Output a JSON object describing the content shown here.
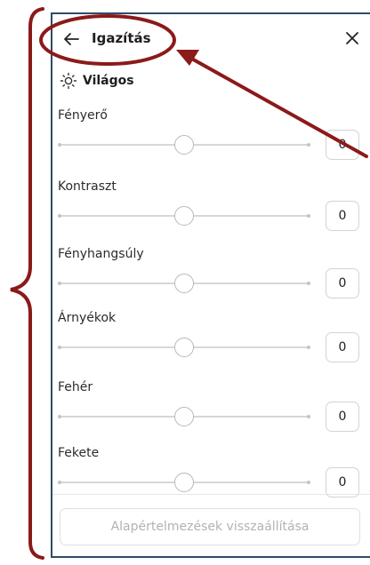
{
  "header": {
    "title": "Igazítás",
    "back_icon": "arrow-left-icon",
    "close_icon": "close-icon"
  },
  "section": {
    "title": "Világos",
    "icon": "sun-icon"
  },
  "sliders": [
    {
      "label": "Fényerő",
      "value": "0",
      "level": 0.5
    },
    {
      "label": "Kontraszt",
      "value": "0",
      "level": 0.5
    },
    {
      "label": "Fényhangsúly",
      "value": "0",
      "level": 0.5
    },
    {
      "label": "Árnyékok",
      "value": "0",
      "level": 0.5
    },
    {
      "label": "Fehér",
      "value": "0",
      "level": 0.5
    },
    {
      "label": "Fekete",
      "value": "0",
      "level": 0.5
    }
  ],
  "footer": {
    "reset_label": "Alapértelmezések visszaállítása"
  },
  "colors": {
    "annotation": "#8b1a1a",
    "panel_border": "#2f4a6a",
    "track": "#d7d7d7"
  }
}
